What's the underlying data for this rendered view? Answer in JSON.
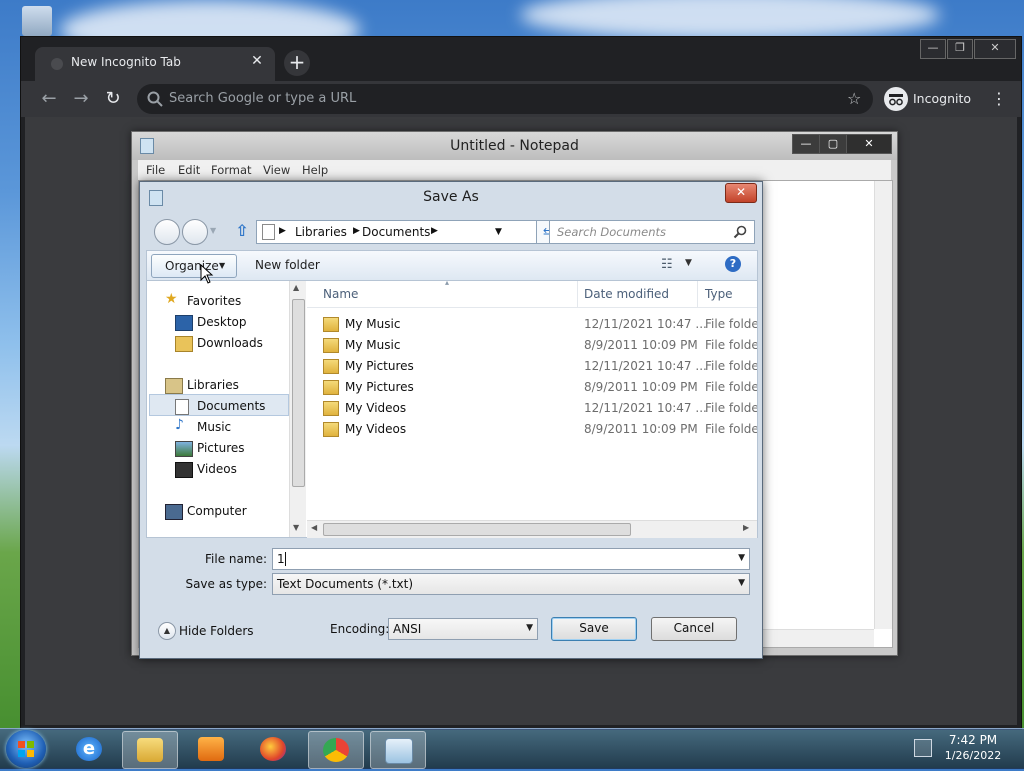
{
  "browser": {
    "tab_title": "New Incognito Tab",
    "tab_close_glyph": "✕",
    "new_tab_glyph": "+",
    "omnibox_placeholder": "Search Google or type a URL",
    "incognito_label": "Incognito",
    "menu_glyph": "⋮"
  },
  "notepad": {
    "title": "Untitled - Notepad",
    "menu": [
      "File",
      "Edit",
      "Format",
      "View",
      "Help"
    ]
  },
  "save_as": {
    "title": "Save As",
    "close_glyph": "✕",
    "breadcrumb": [
      "Libraries",
      "Documents"
    ],
    "search_placeholder": "Search Documents",
    "organize_label": "Organize",
    "new_folder_label": "New folder",
    "help_glyph": "?",
    "nav": {
      "favorites": "Favorites",
      "desktop": "Desktop",
      "downloads": "Downloads",
      "libraries": "Libraries",
      "documents": "Documents",
      "music": "Music",
      "pictures": "Pictures",
      "videos": "Videos",
      "computer": "Computer"
    },
    "columns": {
      "name": "Name",
      "date": "Date modified",
      "type": "Type"
    },
    "rows": [
      {
        "name": "My Music",
        "date": "12/11/2021 10:47 ...",
        "type": "File folder"
      },
      {
        "name": "My Music",
        "date": "8/9/2011 10:09 PM",
        "type": "File folder"
      },
      {
        "name": "My Pictures",
        "date": "12/11/2021 10:47 ...",
        "type": "File folder"
      },
      {
        "name": "My Pictures",
        "date": "8/9/2011 10:09 PM",
        "type": "File folder"
      },
      {
        "name": "My Videos",
        "date": "12/11/2021 10:47 ...",
        "type": "File folder"
      },
      {
        "name": "My Videos",
        "date": "8/9/2011 10:09 PM",
        "type": "File folder"
      }
    ],
    "file_name_label": "File name:",
    "file_name_value": "1",
    "save_type_label": "Save as type:",
    "save_type_value": "Text Documents (*.txt)",
    "hide_folders_label": "Hide Folders",
    "encoding_label": "Encoding:",
    "encoding_value": "ANSI",
    "save_label": "Save",
    "cancel_label": "Cancel"
  },
  "taskbar": {
    "time": "7:42 PM",
    "date": "1/26/2022"
  },
  "colors": {
    "chrome_dark": "#202124",
    "chrome_toolbar": "#35363a",
    "dialog_bg": "#d3dde8",
    "accent_blue": "#2e6cc4"
  }
}
